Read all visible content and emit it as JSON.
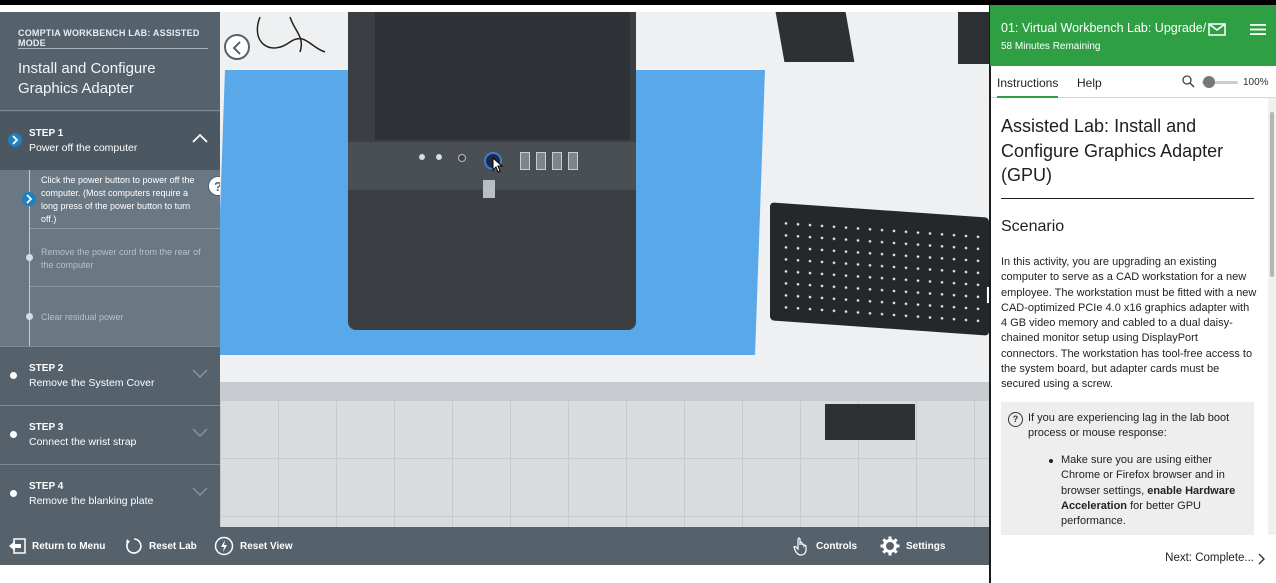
{
  "left_panel": {
    "mode_label": "COMPTIA WORKBENCH LAB: ASSISTED MODE",
    "title": "Install and Configure Graphics Adapter",
    "steps": [
      {
        "number": "STEP 1",
        "name": "Power off the computer"
      },
      {
        "number": "STEP 2",
        "name": "Remove the System Cover"
      },
      {
        "number": "STEP 3",
        "name": "Connect the wrist strap"
      },
      {
        "number": "STEP 4",
        "name": "Remove the blanking plate"
      }
    ],
    "substeps": [
      "Click the power button to power off the computer. (Most computers require a long press of the power button to turn off.)",
      "Remove the power cord from the rear of the computer",
      "Clear residual power"
    ],
    "help_glyph": "?"
  },
  "bottom_bar": {
    "return_label": "Return to Menu",
    "reset_lab_label": "Reset Lab",
    "reset_view_label": "Reset View",
    "controls_label": "Controls",
    "settings_label": "Settings"
  },
  "right_panel": {
    "header_title": "01: Virtual Workbench Lab: Upgrade/",
    "time_remaining": "58 Minutes Remaining",
    "tabs": [
      "Instructions",
      "Help"
    ],
    "zoom": "100%",
    "heading": "Assisted Lab: Install and Configure Graphics Adapter (GPU)",
    "section_title": "Scenario",
    "scenario_text": "In this activity, you are upgrading an existing computer to serve as a CAD workstation for a new employee. The workstation must be fitted with a new CAD-optimized PCIe 4.0 x16 graphics adapter with 4 GB video memory and cabled to a dual daisy-chained monitor setup using DisplayPort connectors. The workstation has tool-free access to the system board, but adapter cards must be secured using a screw.",
    "note_text": "If you are experiencing lag in the lab boot process or mouse response:",
    "note_bullet_1": "Make sure you are using either Chrome or Firefox browser and in browser settings, ",
    "note_bullet_bold": "enable Hardware Acceleration",
    "note_bullet_2": " for better GPU performance.",
    "next_label": "Next: Complete..."
  },
  "colors": {
    "panel_gray": "#55626c",
    "header_green": "#2ea043",
    "mat_blue": "#58a8ea",
    "accent_blue": "#1f7fbf"
  },
  "icons": [
    "back-arrow-icon",
    "chevron-up-icon",
    "chevron-down-icon",
    "help-icon",
    "return-menu-icon",
    "reset-icon",
    "reset-view-icon",
    "hand-icon",
    "gear-icon",
    "mail-icon",
    "hamburger-icon",
    "search-icon",
    "next-chevron-icon"
  ]
}
